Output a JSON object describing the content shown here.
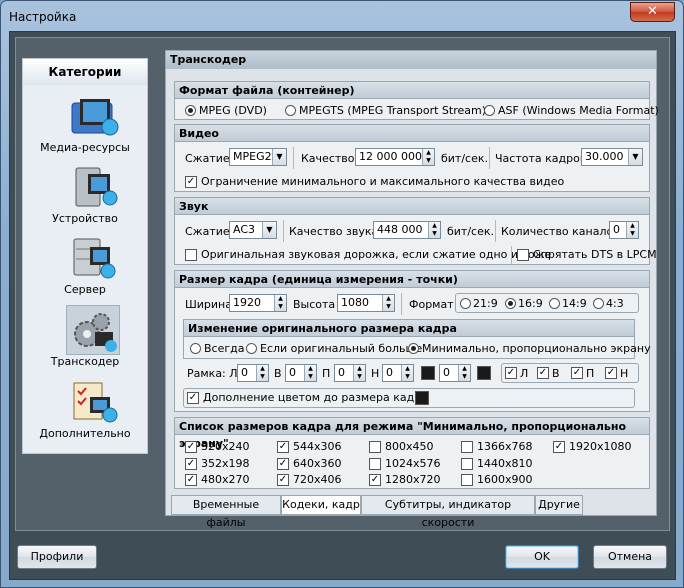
{
  "window": {
    "title": "Настройка",
    "close_label": "✕"
  },
  "categories": {
    "header": "Категории",
    "items": [
      {
        "label": "Медиа-ресурсы",
        "icon": "media-folder-icon"
      },
      {
        "label": "Устройство",
        "icon": "device-icon"
      },
      {
        "label": "Сервер",
        "icon": "server-icon"
      },
      {
        "label": "Транскодер",
        "icon": "transcoder-gears-icon",
        "selected": true
      },
      {
        "label": "Дополнительно",
        "icon": "additional-checklist-icon"
      }
    ]
  },
  "transcoder": {
    "title": "Транскодер",
    "container": {
      "heading": "Формат файла (контейнер)",
      "options": [
        "MPEG (DVD)",
        "MPEGTS (MPEG Transport Stream)",
        "ASF (Windows Media Format)"
      ],
      "selected": "MPEG (DVD)"
    },
    "video": {
      "heading": "Видео",
      "compression_label": "Сжатие",
      "compression_value": "MPEG2",
      "quality_label": "Качество",
      "quality_value": "12 000 000",
      "quality_unit": "бит/сек.",
      "framerate_label": "Частота кадров",
      "framerate_value": "30.000",
      "limit_quality_label": "Ограничение минимального и максимального качества видео",
      "limit_quality_checked": true
    },
    "audio": {
      "heading": "Звук",
      "compression_label": "Сжатие",
      "compression_value": "AC3",
      "quality_label": "Качество звука",
      "quality_value": "448 000",
      "quality_unit": "бит/сек.",
      "channels_label": "Количество каналов",
      "channels_value": "0",
      "original_track_label": "Оригинальная звуковая дорожка, если сжатие одно и тоже",
      "hide_dts_label": "Спрятать DTS в LPCM"
    },
    "frame": {
      "heading": "Размер кадра (единица измерения - точки)",
      "width_label": "Ширина",
      "width_value": "1920",
      "height_label": "Высота",
      "height_value": "1080",
      "format_label": "Формат",
      "formats": [
        "21:9",
        "16:9",
        "14:9",
        "4:3"
      ],
      "format_selected": "16:9",
      "resize": {
        "heading": "Изменение оригинального размера кадра",
        "options": [
          "Всегда",
          "Если оригинальный больше",
          "Минимально, пропорционально экрану"
        ],
        "selected": "Минимально, пропорционально экрану"
      },
      "border_label": "Рамка: Л",
      "border_fields": [
        {
          "label": "Л",
          "value": "0"
        },
        {
          "label": "В",
          "value": "0"
        },
        {
          "label": "П",
          "value": "0"
        },
        {
          "label": "Н",
          "value": "0"
        },
        {
          "label": "",
          "value": "0"
        }
      ],
      "side_checks": [
        "Л",
        "В",
        "П",
        "Н"
      ],
      "fill_color_label": "Дополнение цветом до размера кадра",
      "fill_color_checked": true,
      "fill_color": "#000000"
    },
    "sizes": {
      "heading": "Список размеров кадра для режима \"Минимально, пропорционально экрану\"",
      "items": [
        {
          "label": "320x240",
          "checked": true
        },
        {
          "label": "544x306",
          "checked": true
        },
        {
          "label": "800x450",
          "checked": false
        },
        {
          "label": "1366x768",
          "checked": false
        },
        {
          "label": "1920x1080",
          "checked": true
        },
        {
          "label": "352x198",
          "checked": true
        },
        {
          "label": "640x360",
          "checked": true
        },
        {
          "label": "1024x576",
          "checked": false
        },
        {
          "label": "1440x810",
          "checked": false
        },
        {
          "label": "480x270",
          "checked": true
        },
        {
          "label": "720x406",
          "checked": true
        },
        {
          "label": "1280x720",
          "checked": true
        },
        {
          "label": "1600x900",
          "checked": false
        }
      ]
    },
    "tabs": [
      "Временные файлы",
      "Кодеки, кадр",
      "Субтитры, индикатор скорости",
      "Другие"
    ],
    "active_tab": "Кодеки, кадр"
  },
  "buttons": {
    "profiles": "Профили",
    "ok": "OK",
    "cancel": "Отмена"
  },
  "colors": {
    "accent": "#3c7fb1",
    "background": "#3f4d56"
  }
}
